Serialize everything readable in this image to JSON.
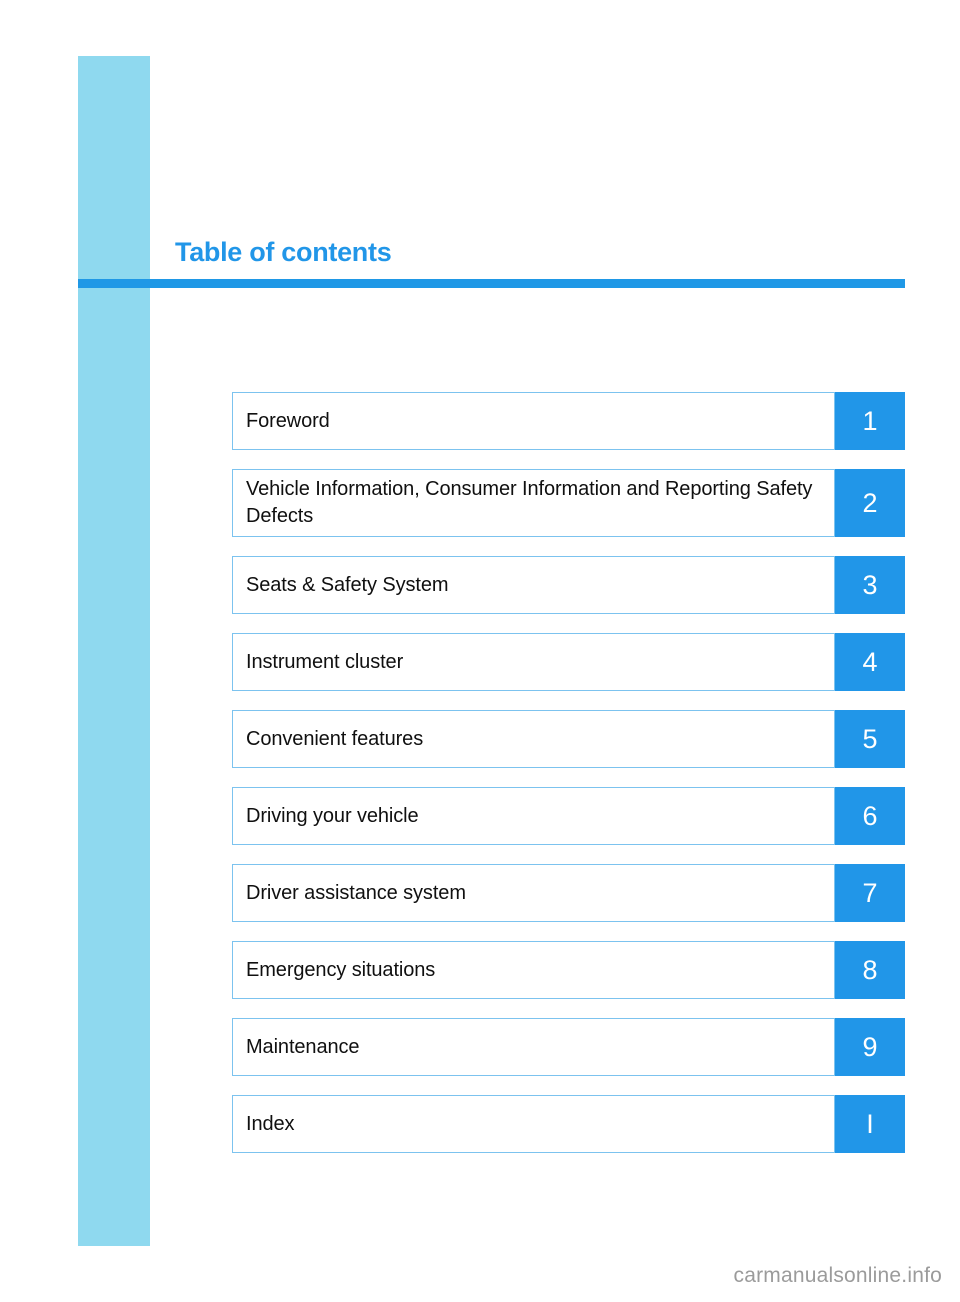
{
  "page": {
    "title": "Table of contents",
    "watermark": "carmanualsonline.info"
  },
  "colors": {
    "accent_blue": "#2196e8",
    "rule_blue": "#1f98e6",
    "side_bar_blue": "#8fd9ef",
    "box_border_blue": "#7cc3ef",
    "label_text": "#101010",
    "watermark_text": "#9b9b9b"
  },
  "contents": [
    {
      "label": "Foreword",
      "badge": "1",
      "lines": 1
    },
    {
      "label": "Vehicle Information, Consumer Information and Reporting Safety Defects",
      "badge": "2",
      "lines": 2
    },
    {
      "label": "Seats & Safety System",
      "badge": "3",
      "lines": 1
    },
    {
      "label": "Instrument cluster",
      "badge": "4",
      "lines": 1
    },
    {
      "label": "Convenient features",
      "badge": "5",
      "lines": 1
    },
    {
      "label": "Driving your vehicle",
      "badge": "6",
      "lines": 1
    },
    {
      "label": "Driver assistance system",
      "badge": "7",
      "lines": 1
    },
    {
      "label": "Emergency situations",
      "badge": "8",
      "lines": 1
    },
    {
      "label": "Maintenance",
      "badge": "9",
      "lines": 1
    },
    {
      "label": "Index",
      "badge": "I",
      "lines": 1
    }
  ]
}
